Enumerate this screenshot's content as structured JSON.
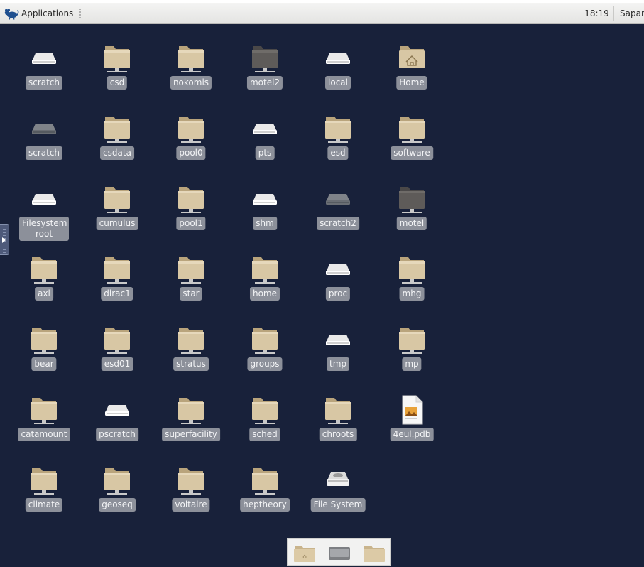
{
  "panel": {
    "applications_label": "Applications",
    "clock": "18:19",
    "user": "Sapar"
  },
  "desktop": {
    "icons": [
      {
        "label": "scratch",
        "type": "drive"
      },
      {
        "label": "csd",
        "type": "folder"
      },
      {
        "label": "nokomis",
        "type": "folder"
      },
      {
        "label": "motel2",
        "type": "folder-dark"
      },
      {
        "label": "local",
        "type": "drive"
      },
      {
        "label": "Home",
        "type": "home"
      },
      {
        "label": "scratch",
        "type": "drive-dark"
      },
      {
        "label": "csdata",
        "type": "folder"
      },
      {
        "label": "pool0",
        "type": "folder"
      },
      {
        "label": "pts",
        "type": "drive"
      },
      {
        "label": "esd",
        "type": "folder"
      },
      {
        "label": "software",
        "type": "folder"
      },
      {
        "label": "Filesystem root",
        "type": "drive"
      },
      {
        "label": "cumulus",
        "type": "folder"
      },
      {
        "label": "pool1",
        "type": "folder"
      },
      {
        "label": "shm",
        "type": "drive"
      },
      {
        "label": "scratch2",
        "type": "drive-dark"
      },
      {
        "label": "motel",
        "type": "folder-dark"
      },
      {
        "label": "axl",
        "type": "folder"
      },
      {
        "label": "dirac1",
        "type": "folder"
      },
      {
        "label": "star",
        "type": "folder"
      },
      {
        "label": "home",
        "type": "folder"
      },
      {
        "label": "proc",
        "type": "drive"
      },
      {
        "label": "mhg",
        "type": "folder"
      },
      {
        "label": "bear",
        "type": "folder"
      },
      {
        "label": "esd01",
        "type": "folder"
      },
      {
        "label": "stratus",
        "type": "folder"
      },
      {
        "label": "groups",
        "type": "folder"
      },
      {
        "label": "tmp",
        "type": "drive"
      },
      {
        "label": "mp",
        "type": "folder"
      },
      {
        "label": "catamount",
        "type": "folder"
      },
      {
        "label": "pscratch",
        "type": "drive"
      },
      {
        "label": "superfacility",
        "type": "folder"
      },
      {
        "label": "sched",
        "type": "folder"
      },
      {
        "label": "chroots",
        "type": "folder"
      },
      {
        "label": "4eul.pdb",
        "type": "file"
      },
      {
        "label": "climate",
        "type": "folder"
      },
      {
        "label": "geoseq",
        "type": "folder"
      },
      {
        "label": "voltaire",
        "type": "folder"
      },
      {
        "label": "heptheory",
        "type": "folder"
      },
      {
        "label": "File System",
        "type": "filesystem"
      }
    ]
  },
  "dock": {
    "items": [
      {
        "icon": "home-folder-icon"
      },
      {
        "icon": "drive-icon"
      },
      {
        "icon": "folder-icon"
      }
    ]
  },
  "colors": {
    "desktop_bg": "#18213a",
    "label_bg": "#8c909a",
    "folder": "#d8c7a4"
  }
}
